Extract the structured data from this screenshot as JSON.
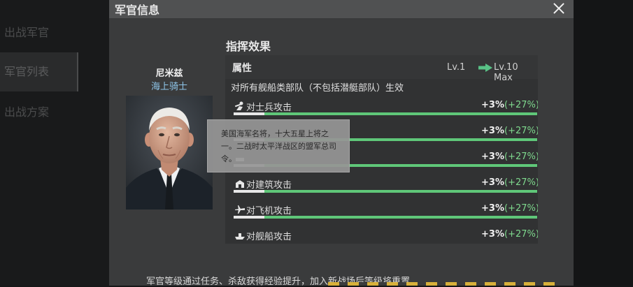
{
  "sidebar": {
    "items": [
      {
        "label": "出战军官"
      },
      {
        "label": "军官列表"
      },
      {
        "label": "出战方案"
      }
    ]
  },
  "modal": {
    "title": "军官信息",
    "close_icon": "close-icon"
  },
  "officer": {
    "name": "尼米兹",
    "title": "海上骑士",
    "info_icon": "info-diamond-icon",
    "tooltip": "美国海军名将，十大五星上将之一。二战时太平洋战区的盟军总司令。"
  },
  "command_effect": {
    "section_title": "指挥效果",
    "header": {
      "attribute": "属性",
      "lv1": "Lv.1",
      "lv10": "Lv.10 Max"
    },
    "scope": "对所有舰船类部队（不包括潜艇部队）生效",
    "rows": [
      {
        "label": "对士兵攻击",
        "value": "+3%",
        "max": "(+27%)",
        "icon": "soldier-attack-icon"
      },
      {
        "label": "",
        "value": "+3%",
        "max": "(+27%)",
        "icon": "vehicle-attack-icon"
      },
      {
        "label": "",
        "value": "+3%",
        "max": "(+27%)",
        "icon": "tank-attack-icon"
      },
      {
        "label": "对建筑攻击",
        "value": "+3%",
        "max": "(+27%)",
        "icon": "building-attack-icon"
      },
      {
        "label": "对飞机攻击",
        "value": "+3%",
        "max": "(+27%)",
        "icon": "aircraft-attack-icon"
      },
      {
        "label": "对舰船攻击",
        "value": "+3%",
        "max": "(+27%)",
        "icon": "ship-attack-icon"
      }
    ]
  },
  "footer_text": "军官等级通过任务、杀敌获得经验提升，加入新战场后等级将重置",
  "colors": {
    "bar_green": "#5fc779",
    "accent_green": "#7fd98e",
    "title_blue": "#8fc6ea"
  }
}
